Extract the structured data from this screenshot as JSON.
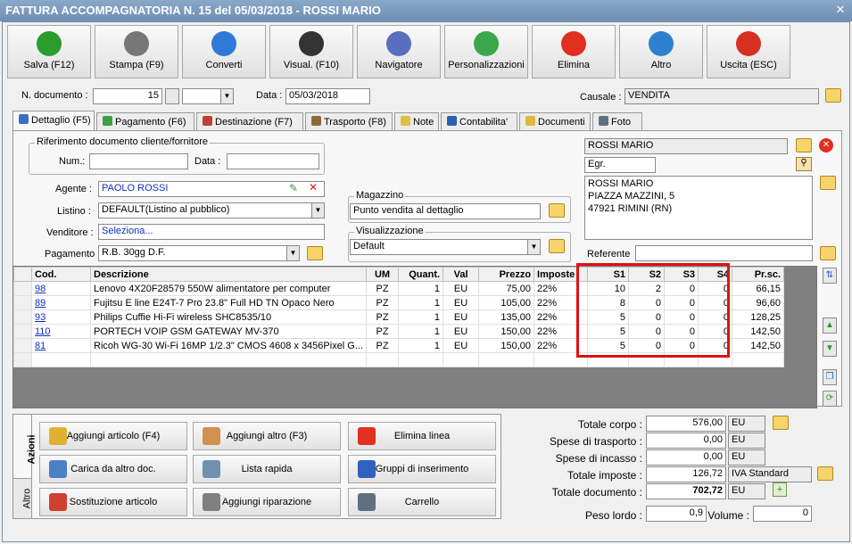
{
  "window": {
    "title": "FATTURA ACCOMPAGNATORIA N. 15 del 05/03/2018 - ROSSI MARIO",
    "close_label": "✕"
  },
  "toolbar": [
    {
      "name": "salva",
      "label": "Salva (F12)",
      "icon": "check-icon",
      "color": "#2a9d2a"
    },
    {
      "name": "stampa",
      "label": "Stampa (F9)",
      "icon": "printer-icon",
      "color": "#777777"
    },
    {
      "name": "converti",
      "label": "Converti",
      "icon": "convert-icon",
      "color": "#2f7ad8"
    },
    {
      "name": "visual",
      "label": "Visual. (F10)",
      "icon": "magic-wand-icon",
      "color": "#333333"
    },
    {
      "name": "navigatore",
      "label": "Navigatore",
      "icon": "compass-icon",
      "color": "#5a6ec0"
    },
    {
      "name": "personalizzazioni",
      "label": "Personalizzazioni",
      "icon": "puzzle-icon",
      "color": "#3aa84a"
    },
    {
      "name": "elimina",
      "label": "Elimina",
      "icon": "delete-x-icon",
      "color": "#e03020"
    },
    {
      "name": "altro",
      "label": "Altro",
      "icon": "magnifier-icon",
      "color": "#3080d0"
    },
    {
      "name": "uscita",
      "label": "Uscita (ESC)",
      "icon": "power-icon",
      "color": "#d83020"
    }
  ],
  "header": {
    "ndoc_label": "N. documento :",
    "ndoc_value": "15",
    "data_label": "Data :",
    "data_value": "05/03/2018",
    "causale_label": "Causale :",
    "causale_value": "VENDITA"
  },
  "tabs": [
    {
      "label": "Dettaglio (F5)",
      "color": "#3a70c0"
    },
    {
      "label": "Pagamento (F6)",
      "color": "#3aa040"
    },
    {
      "label": "Destinazione (F7)",
      "color": "#c04030"
    },
    {
      "label": "Trasporto (F8)",
      "color": "#8a6a3a"
    },
    {
      "label": "Note",
      "color": "#e0c040"
    },
    {
      "label": "Contabilita'",
      "color": "#2a60b0"
    },
    {
      "label": "Documenti",
      "color": "#e0b840"
    },
    {
      "label": "Foto",
      "color": "#607080"
    }
  ],
  "rif": {
    "title": "Riferimento documento cliente/fornitore",
    "num_label": "Num.:",
    "data_label": "Data :"
  },
  "form": {
    "agente_label": "Agente :",
    "agente_value": "PAOLO ROSSI",
    "listino_label": "Listino :",
    "listino_value": "DEFAULT(Listino al pubblico)",
    "venditore_label": "Venditore :",
    "venditore_value": "Seleziona...",
    "pagamento_label": "Pagamento :",
    "pagamento_value": "R.B. 30gg D.F."
  },
  "magazzino": {
    "title": "Magazzino",
    "value": "Punto vendita al dettaglio"
  },
  "visualizzazione": {
    "title": "Visualizzazione",
    "value": "Default"
  },
  "cliente": {
    "name": "ROSSI MARIO",
    "title": "Egr.",
    "address": [
      "ROSSI MARIO",
      "PIAZZA MAZZINI, 5",
      "47921 RIMINI (RN)"
    ],
    "referente_label": "Referente"
  },
  "grid": {
    "columns": [
      "Cod.",
      "Descrizione",
      "UM",
      "Quant.",
      "Val",
      "Prezzo",
      "Imposte",
      "S1",
      "S2",
      "S3",
      "S4",
      "Pr.sc."
    ],
    "rows": [
      [
        "98",
        "Lenovo 4X20F28579 550W alimentatore per computer",
        "PZ",
        "1",
        "EU",
        "75,00",
        "22%",
        "10",
        "2",
        "0",
        "0",
        "66,15"
      ],
      [
        "89",
        "Fujitsu E line E24T-7 Pro 23.8\" Full HD TN Opaco Nero",
        "PZ",
        "1",
        "EU",
        "105,00",
        "22%",
        "8",
        "0",
        "0",
        "0",
        "96,60"
      ],
      [
        "93",
        "Philips Cuffie Hi-Fi wireless SHC8535/10",
        "PZ",
        "1",
        "EU",
        "135,00",
        "22%",
        "5",
        "0",
        "0",
        "0",
        "128,25"
      ],
      [
        "110",
        "PORTECH VOIP GSM GATEWAY MV-370",
        "PZ",
        "1",
        "EU",
        "150,00",
        "22%",
        "5",
        "0",
        "0",
        "0",
        "142,50"
      ],
      [
        "81",
        "Ricoh WG-30 Wi-Fi 16MP 1/2.3\" CMOS 4608 x 3456Pixel G...",
        "PZ",
        "1",
        "EU",
        "150,00",
        "22%",
        "5",
        "0",
        "0",
        "0",
        "142,50"
      ]
    ]
  },
  "actions": {
    "tab_azioni": "Azioni",
    "tab_altro": "Altro",
    "buttons": [
      {
        "label": "Aggiungi articolo (F4)",
        "icon": "add-article-icon",
        "color": "#e0b030"
      },
      {
        "label": "Aggiungi altro (F3)",
        "icon": "add-grid-icon",
        "color": "#d09050"
      },
      {
        "label": "Elimina linea",
        "icon": "delete-x-icon",
        "color": "#e03020"
      },
      {
        "label": "Carica da altro doc.",
        "icon": "load-doc-icon",
        "color": "#4a80c8"
      },
      {
        "label": "Lista rapida",
        "icon": "quick-list-icon",
        "color": "#7090b0"
      },
      {
        "label": "Gruppi di inserimento",
        "icon": "groups-icon",
        "color": "#3060c0"
      },
      {
        "label": "Sostituzione articolo",
        "icon": "replace-icon",
        "color": "#d04030"
      },
      {
        "label": "Aggiungi riparazione",
        "icon": "wrench-icon",
        "color": "#808080"
      },
      {
        "label": "Carrello",
        "icon": "cart-icon",
        "color": "#607080"
      }
    ]
  },
  "totals": {
    "corpo_label": "Totale corpo :",
    "corpo_value": "576,00",
    "corpo_cur": "EU",
    "trasporto_label": "Spese di trasporto :",
    "trasporto_value": "0,00",
    "trasporto_cur": "EU",
    "incasso_label": "Spese di incasso :",
    "incasso_value": "0,00",
    "incasso_cur": "EU",
    "imposte_label": "Totale imposte :",
    "imposte_value": "126,72",
    "imposte_desc": "IVA Standard",
    "documento_label": "Totale documento :",
    "documento_value": "702,72",
    "documento_cur": "EU",
    "peso_label": "Peso lordo :",
    "peso_value": "0,9",
    "volume_label": "Volume :",
    "volume_value": "0"
  }
}
